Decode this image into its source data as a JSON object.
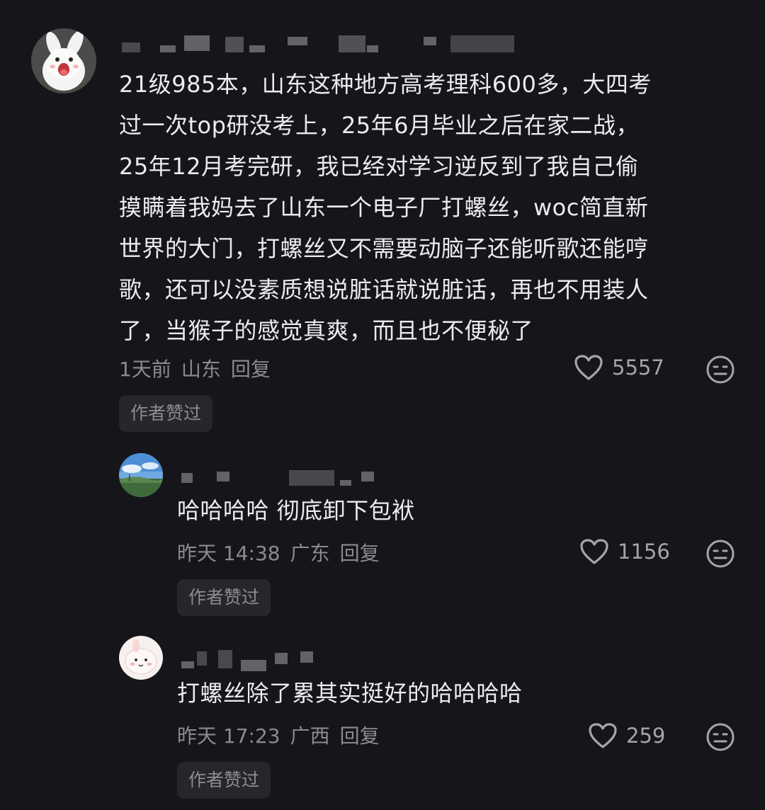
{
  "comments": [
    {
      "avatar_icon": "rabbit-avatar-icon",
      "text": "21级985本，山东这种地方高考理科600多，大四考\n过一次top研没考上，25年6月毕业之后在家二战，\n25年12月考完研，我已经对学习逆反到了我自己偷\n摸瞒着我妈去了山东一个电子厂打螺丝，woc简直新\n世界的大门，打螺丝又不需要动脑子还能听歌还能哼\n歌，还可以没素质想说脏话就说脏话，再也不用装人\n了，当猴子的感觉真爽，而且也不便秘了",
      "time": "1天前",
      "region": "山东",
      "reply_label": "回复",
      "likes": "5557",
      "badge": "作者赞过"
    },
    {
      "avatar_icon": "landscape-avatar-icon",
      "text": "哈哈哈哈 彻底卸下包袱",
      "time": "昨天 14:38",
      "region": "广东",
      "reply_label": "回复",
      "likes": "1156",
      "badge": "作者赞过"
    },
    {
      "avatar_icon": "cartoon-avatar-icon",
      "text": "打螺丝除了累其实挺好的哈哈哈哈",
      "time": "昨天 17:23",
      "region": "广西",
      "reply_label": "回复",
      "likes": "259",
      "badge": "作者赞过"
    }
  ],
  "icons": {
    "like": "heart-outline-icon",
    "dislike": "meh-face-icon"
  },
  "colors": {
    "background": "#16161a",
    "text": "#ececee",
    "meta": "#8a8a90",
    "badge_bg": "#26262b"
  }
}
